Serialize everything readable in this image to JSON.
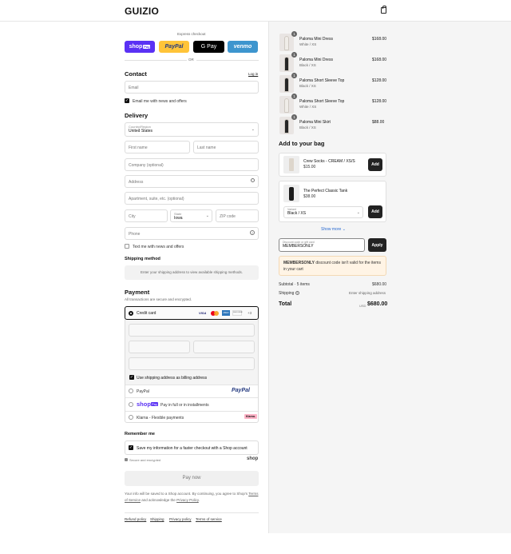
{
  "brand": {
    "logo": "GUIZIO",
    "bag_icon": "shopping-bag-icon"
  },
  "express": {
    "label": "Express checkout",
    "shop": "shop",
    "shop_pay": "Pay",
    "paypal": "PayPal",
    "gpay": "G Pay",
    "venmo": "venmo",
    "or": "OR"
  },
  "contact": {
    "title": "Contact",
    "login": "Log in",
    "email_placeholder": "Email",
    "news_label": "Email me with news and offers"
  },
  "delivery": {
    "title": "Delivery",
    "country_label": "Country/Region",
    "country": "United States",
    "first_name": "First name",
    "last_name": "Last name",
    "company": "Company (optional)",
    "address": "Address",
    "apartment": "Apartment, suite, etc. (optional)",
    "city": "City",
    "state_label": "State",
    "state": "Iowa",
    "zip": "ZIP code",
    "phone": "Phone",
    "text_label": "Text me with news and offers"
  },
  "shipping": {
    "title": "Shipping method",
    "placeholder": "Enter your shipping address to view available shipping methods."
  },
  "payment": {
    "title": "Payment",
    "subtitle": "All transactions are secure and encrypted.",
    "credit_card": "Credit card",
    "visa": "VISA",
    "amex": "AMEX",
    "discover": "DISCOVER",
    "more": "+3",
    "billing_label": "Use shipping address as billing address",
    "paypal": "PayPal",
    "paypal_logo": "PayPal",
    "shoppay_logo": "shop",
    "shoppay_badge": "Pay",
    "shoppay_text": "Pay in full or in installments",
    "klarna": "Klarna - Flexible payments",
    "klarna_badge": "Klarna."
  },
  "remember": {
    "title": "Remember me",
    "save_label": "Save my information for a faster checkout with a Shop account",
    "secure": "Secure and encrypted",
    "shop": "shop"
  },
  "pay_now": "Pay now",
  "disclaimer1": "Your info will be saved to a Shop account. By continuing, you agree to Shop's",
  "terms": "Terms of Service",
  "disclaimer_and": "and acknowledge the",
  "privacy": "Privacy Policy",
  "footer": {
    "refund": "Refund policy",
    "shipping": "Shipping",
    "privacy": "Privacy policy",
    "terms": "Terms of service"
  },
  "cart": {
    "items": [
      {
        "name": "Paloma Mini Dress",
        "variant": "White / XS",
        "price": "$168.00",
        "qty": "1"
      },
      {
        "name": "Paloma Mini Dress",
        "variant": "Black / XS",
        "price": "$168.00",
        "qty": "1"
      },
      {
        "name": "Paloma Short Sleeve Top",
        "variant": "Black / XS",
        "price": "$128.00",
        "qty": "1"
      },
      {
        "name": "Paloma Short Sleeve Top",
        "variant": "White / XS",
        "price": "$128.00",
        "qty": "1"
      },
      {
        "name": "Paloma Mini Skirt",
        "variant": "Black / XS",
        "price": "$88.00",
        "qty": "1"
      }
    ]
  },
  "upsell": {
    "title": "Add to your bag",
    "item1_name": "Crew Socks - CREAM / XS/S",
    "item1_price": "$15.00",
    "item2_name": "The Perfect Classic Tank",
    "item2_price": "$38.00",
    "variant_label": "Variant",
    "variant": "Black / XS",
    "add": "Add",
    "show_more": "Show more"
  },
  "discount": {
    "label": "Discount code or gift card",
    "value": "MEMBERSONLY",
    "apply": "Apply",
    "error_code": "MEMBERSONLY",
    "error_text": "discount code isn't valid for the items in your cart"
  },
  "summary": {
    "subtotal_label": "Subtotal · 5 items",
    "subtotal": "$680.00",
    "shipping_label": "Shipping",
    "shipping_value": "Enter shipping address",
    "total_label": "Total",
    "currency": "USD",
    "total": "$680.00"
  }
}
